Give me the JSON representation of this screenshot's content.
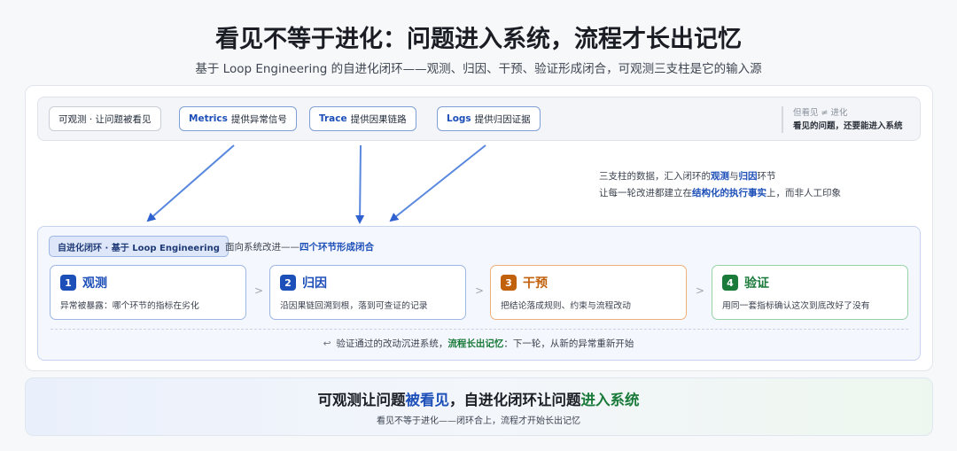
{
  "title": "看见不等于进化：问题进入系统，流程才长出记忆",
  "subtitle": "基于 Loop Engineering 的自进化闭环——观测、归因、干预、验证形成闭合，可观测三支柱是它的输入源",
  "pillars": {
    "observe_chip": "可观测 · 让问题被看见",
    "items": [
      {
        "name": "Metrics",
        "desc": "提供异常信号"
      },
      {
        "name": "Trace",
        "desc": "提供因果链路"
      },
      {
        "name": "Logs",
        "desc": "提供归因证据"
      }
    ],
    "note_line1": "但看见 ≠ 进化",
    "note_line2": "看见的问题，还要能进入系统"
  },
  "side_note": {
    "line1_a": "三支柱的数据，汇入闭环的",
    "line1_b": "观测",
    "line1_c": "与",
    "line1_d": "归因",
    "line1_e": "环节",
    "line2_a": "让每一轮改进都建立在",
    "line2_b": "结构化的执行事实",
    "line2_c": "上，而非人工印象"
  },
  "loop": {
    "tag": "自进化闭环 · 基于 Loop Engineering",
    "caption_a": "面向系统改进——",
    "caption_b": "四个环节形成闭合",
    "steps": [
      {
        "num": "1",
        "name": "观测",
        "desc": "异常被暴露：哪个环节的指标在劣化",
        "color": "#1d4fb8",
        "border": "#9db6e4"
      },
      {
        "num": "2",
        "name": "归因",
        "desc": "沿因果链回溯到根，落到可查证的记录",
        "color": "#1d4fb8",
        "border": "#9db6e4"
      },
      {
        "num": "3",
        "name": "干预",
        "desc": "把结论落成规则、约束与流程改动",
        "color": "#c2610c",
        "border": "#eeb07a"
      },
      {
        "num": "4",
        "name": "验证",
        "desc": "用同一套指标确认这次到底改好了没有",
        "color": "#1a7a3a",
        "border": "#94d3a6"
      }
    ],
    "chevron": ">",
    "footer_icon": "↩",
    "footer_a": "验证通过的改动沉进系统，",
    "footer_b": "流程长出记忆",
    "footer_c": "：下一轮，从新的异常重新开始"
  },
  "banner": {
    "main_a": "可观测让问题",
    "main_b": "被看见",
    "main_c": "，自进化闭环让问题",
    "main_d": "进入系统",
    "sub": "看见不等于进化——闭环合上，流程才开始长出记忆"
  },
  "colors": {
    "accent_blue": "#1d4fb8",
    "accent_orange": "#c2610c",
    "accent_green": "#1a7a3a",
    "arrow_blue": "#4a7fdc"
  }
}
